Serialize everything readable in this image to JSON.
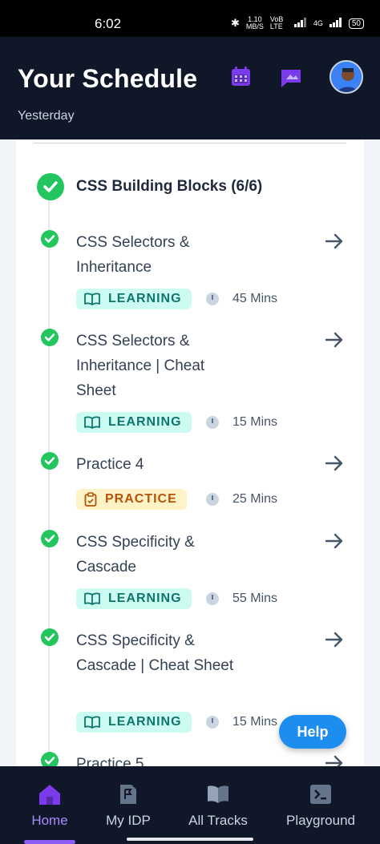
{
  "status_bar": {
    "time": "6:02",
    "speed": "1.10",
    "speed_unit": "MB/S",
    "net1": "VoB LTE",
    "net2": "4G",
    "battery": "50"
  },
  "header": {
    "title": "Your Schedule",
    "subtitle": "Yesterday"
  },
  "section": {
    "title": "CSS Building Blocks (6/6)"
  },
  "items": [
    {
      "title": "CSS Selectors & Inheritance",
      "badge": "LEARNING",
      "type": "learning",
      "duration": "45 Mins"
    },
    {
      "title": "CSS Selectors & Inheritance | Cheat Sheet",
      "badge": "LEARNING",
      "type": "learning",
      "duration": "15 Mins"
    },
    {
      "title": "Practice 4",
      "badge": "PRACTICE",
      "type": "practice",
      "duration": "25 Mins"
    },
    {
      "title": "CSS Specificity & Cascade",
      "badge": "LEARNING",
      "type": "learning",
      "duration": "55 Mins"
    },
    {
      "title": "CSS Specificity & Cascade | Cheat Sheet",
      "badge": "LEARNING",
      "type": "learning",
      "duration": "15 Mins"
    },
    {
      "title": "Practice 5"
    }
  ],
  "help_label": "Help",
  "nav": [
    {
      "label": "Home",
      "active": true
    },
    {
      "label": "My IDP"
    },
    {
      "label": "All Tracks"
    },
    {
      "label": "Playground"
    }
  ],
  "colors": {
    "header_bg": "#0f1729",
    "success": "#22c55e",
    "accent": "#8b5cf6",
    "help": "#1d8ef0"
  }
}
